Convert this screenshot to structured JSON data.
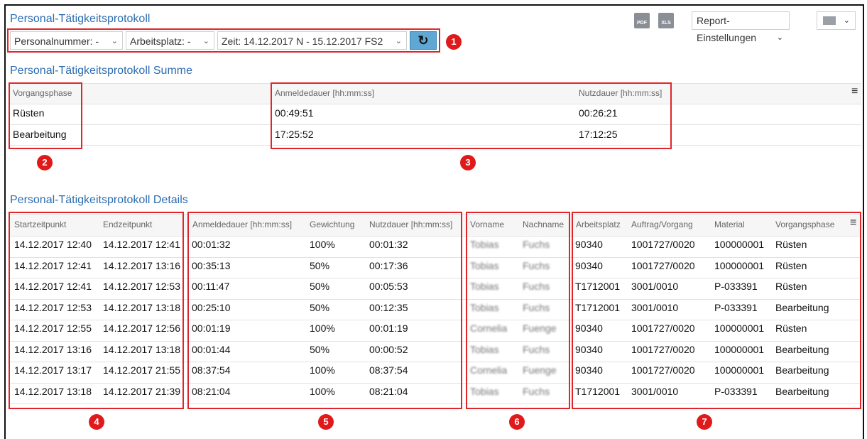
{
  "header": {
    "title": "Personal-Tätigkeitsprotokoll",
    "pdf_label": "PDF",
    "xls_label": "XLS",
    "report_settings": "Report-Einstellungen"
  },
  "filters": {
    "personalnummer": "Personalnummer: -",
    "arbeitsplatz": "Arbeitsplatz: -",
    "zeit": "Zeit: 14.12.2017 N - 15.12.2017 FS2"
  },
  "summary": {
    "title": "Personal-Tätigkeitsprotokoll Summe",
    "columns": [
      "Vorgangsphase",
      "Anmeldedauer [hh:mm:ss]",
      "Nutzdauer [hh:mm:ss]"
    ],
    "rows": [
      [
        "Rüsten",
        "00:49:51",
        "00:26:21"
      ],
      [
        "Bearbeitung",
        "17:25:52",
        "17:12:25"
      ]
    ]
  },
  "details": {
    "title": "Personal-Tätigkeitsprotokoll Details",
    "columns": [
      "Startzeitpunkt",
      "Endzeitpunkt",
      "Anmeldedauer [hh:mm:ss]",
      "Gewichtung",
      "Nutzdauer [hh:mm:ss]",
      "Vorname",
      "Nachname",
      "Arbeitsplatz",
      "Auftrag/Vorgang",
      "Material",
      "Vorgangsphase"
    ],
    "rows": [
      [
        "14.12.2017 12:40",
        "14.12.2017 12:41",
        "00:01:32",
        "100%",
        "00:01:32",
        "Tobias",
        "Fuchs",
        "90340",
        "1001727/0020",
        "100000001",
        "Rüsten"
      ],
      [
        "14.12.2017 12:41",
        "14.12.2017 13:16",
        "00:35:13",
        "50%",
        "00:17:36",
        "Tobias",
        "Fuchs",
        "90340",
        "1001727/0020",
        "100000001",
        "Rüsten"
      ],
      [
        "14.12.2017 12:41",
        "14.12.2017 12:53",
        "00:11:47",
        "50%",
        "00:05:53",
        "Tobias",
        "Fuchs",
        "T1712001",
        "3001/0010",
        "P-033391",
        "Rüsten"
      ],
      [
        "14.12.2017 12:53",
        "14.12.2017 13:18",
        "00:25:10",
        "50%",
        "00:12:35",
        "Tobias",
        "Fuchs",
        "T1712001",
        "3001/0010",
        "P-033391",
        "Bearbeitung"
      ],
      [
        "14.12.2017 12:55",
        "14.12.2017 12:56",
        "00:01:19",
        "100%",
        "00:01:19",
        "Cornelia",
        "Fuenge",
        "90340",
        "1001727/0020",
        "100000001",
        "Rüsten"
      ],
      [
        "14.12.2017 13:16",
        "14.12.2017 13:18",
        "00:01:44",
        "50%",
        "00:00:52",
        "Tobias",
        "Fuchs",
        "90340",
        "1001727/0020",
        "100000001",
        "Bearbeitung"
      ],
      [
        "14.12.2017 13:17",
        "14.12.2017 21:55",
        "08:37:54",
        "100%",
        "08:37:54",
        "Cornelia",
        "Fuenge",
        "90340",
        "1001727/0020",
        "100000001",
        "Bearbeitung"
      ],
      [
        "14.12.2017 13:18",
        "14.12.2017 21:39",
        "08:21:04",
        "100%",
        "08:21:04",
        "Tobias",
        "Fuchs",
        "T1712001",
        "3001/0010",
        "P-033391",
        "Bearbeitung"
      ]
    ]
  },
  "badges": [
    "1",
    "2",
    "3",
    "4",
    "5",
    "6",
    "7"
  ]
}
